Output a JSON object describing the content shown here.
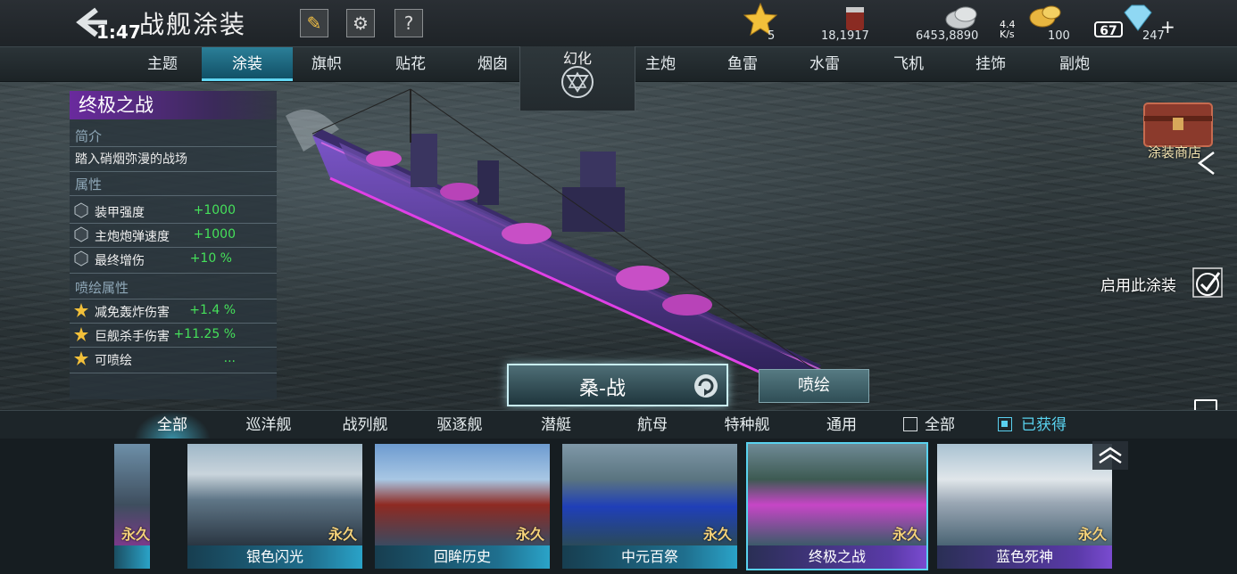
{
  "header": {
    "clock": "1:47",
    "title": "战舰涂装",
    "resources": [
      {
        "icon": "star-icon",
        "value": "5"
      },
      {
        "icon": "paint-bucket-icon",
        "value": "18,1917"
      },
      {
        "icon": "silver-coins-icon",
        "value": "6453,8890"
      },
      {
        "icon": "gold-coins-icon",
        "value": "100"
      },
      {
        "icon": "diamond-icon",
        "value": "247"
      }
    ],
    "network_speed": "4.4\nK/s",
    "battery": "67"
  },
  "tabs": [
    {
      "label": "主题",
      "active": false
    },
    {
      "label": "涂装",
      "active": true
    },
    {
      "label": "旗帜",
      "active": false
    },
    {
      "label": "贴花",
      "active": false
    },
    {
      "label": "烟囱",
      "active": false
    },
    {
      "label": "主炮",
      "active": false
    },
    {
      "label": "鱼雷",
      "active": false
    },
    {
      "label": "水雷",
      "active": false
    },
    {
      "label": "飞机",
      "active": false
    },
    {
      "label": "挂饰",
      "active": false
    },
    {
      "label": "副炮",
      "active": false
    }
  ],
  "transform": {
    "label": "幻化"
  },
  "info": {
    "title": "终极之战",
    "intro_heading": "简介",
    "intro_text": "踏入硝烟弥漫的战场",
    "attr_heading": "属性",
    "attrs": [
      {
        "label": "装甲强度",
        "value": "+1000"
      },
      {
        "label": "主炮炮弹速度",
        "value": "+1000"
      },
      {
        "label": "最终增伤",
        "value": "+10 %"
      }
    ],
    "paint_heading": "喷绘属性",
    "paint_attrs": [
      {
        "label": "减免轰炸伤害",
        "value": "+1.4 %"
      },
      {
        "label": "巨舰杀手伤害",
        "value": "+11.25 %"
      },
      {
        "label": "可喷绘",
        "value": "..."
      }
    ]
  },
  "right": {
    "shop_label": "涂装商店",
    "apply_label": "启用此涂装"
  },
  "center": {
    "skin_name": "桑-战",
    "paint_button": "喷绘"
  },
  "filters": {
    "types": [
      {
        "label": "全部",
        "active": true
      },
      {
        "label": "巡洋舰",
        "active": false
      },
      {
        "label": "战列舰",
        "active": false
      },
      {
        "label": "驱逐舰",
        "active": false
      },
      {
        "label": "潜艇",
        "active": false
      },
      {
        "label": "航母",
        "active": false
      },
      {
        "label": "特种舰",
        "active": false
      },
      {
        "label": "通用",
        "active": false
      }
    ],
    "all_label": "全部",
    "owned_label": "已获得"
  },
  "cards": [
    {
      "name": "",
      "badge": "永久",
      "selected": false
    },
    {
      "name": "银色闪光",
      "badge": "永久",
      "selected": false
    },
    {
      "name": "回眸历史",
      "badge": "永久",
      "selected": false
    },
    {
      "name": "中元百祭",
      "badge": "永久",
      "selected": false
    },
    {
      "name": "终极之战",
      "badge": "永久",
      "selected": true
    },
    {
      "name": "蓝色死神",
      "badge": "永久",
      "selected": false
    }
  ],
  "colors": {
    "accent": "#59d2ef",
    "positive": "#45e05a",
    "title_purple": "#6a2a9e",
    "badge_gold": "#f4d17a"
  }
}
